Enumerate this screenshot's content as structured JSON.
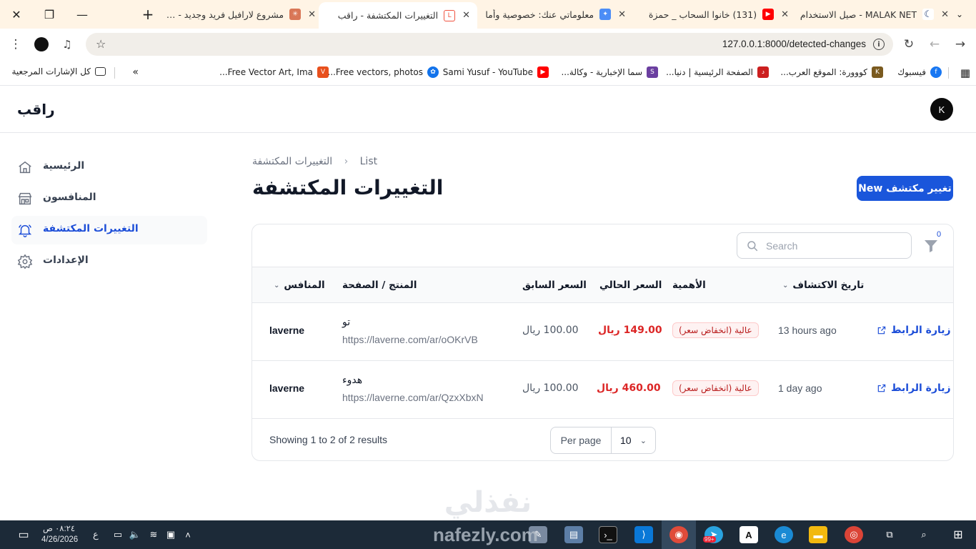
{
  "browser": {
    "tabs": [
      {
        "title": "MALAK NET - صيل الاستخدام",
        "favicon": "moon-icon"
      },
      {
        "title": "(131) خانوا السحاب _ حمزة",
        "favicon": "youtube-icon"
      },
      {
        "title": "معلوماتي عنك: خصوصية وأما",
        "favicon": "gemini-icon"
      },
      {
        "title": "التغييرات المكتشفة - راقب",
        "favicon": "laravel-icon",
        "active": true
      },
      {
        "title": "مشروع لارافيل فريد وجديد - Ide",
        "favicon": "claude-icon"
      }
    ],
    "url": "127.0.0.1:8000/detected-changes",
    "bookmarks": [
      {
        "label": "فيسبوك",
        "color": "#1877f2"
      },
      {
        "label": "كووورة: الموقع العرب...",
        "color": "#7a5a1f"
      },
      {
        "label": "الصفحة الرئيسية | دنيا...",
        "color": "#cc1f1f"
      },
      {
        "label": "سما الإخبارية - وكالة...",
        "color": "#6b3fa0"
      },
      {
        "label": "Sami Yusuf - YouTube",
        "color": "#ff0000"
      },
      {
        "label": "Free vectors, photos...",
        "color": "#1273eb"
      },
      {
        "label": "Free Vector Art, Ima...",
        "color": "#e8501d"
      }
    ],
    "all_bookmarks": "كل الإشارات المرجعية"
  },
  "app": {
    "brand": "راقب",
    "avatar": "K",
    "accent": "#1a56db"
  },
  "sidebar": {
    "items": [
      {
        "label": "الرئيسية",
        "icon": "home-icon"
      },
      {
        "label": "المنافسون",
        "icon": "store-icon"
      },
      {
        "label": "التغييرات المكتشفة",
        "icon": "bell-icon",
        "active": true
      },
      {
        "label": "الإعدادات",
        "icon": "gear-icon"
      }
    ]
  },
  "page": {
    "breadcrumb": [
      "التغييرات المكتشفة",
      "List"
    ],
    "title": "التغييرات المكتشفة",
    "new_button": "تغيير مكتشف New"
  },
  "table": {
    "search_placeholder": "Search",
    "filter_count": "0",
    "columns": {
      "date": "تاريخ الاكتشاف",
      "importance": "الأهمية",
      "current_price": "السعر الحالي",
      "previous_price": "السعر السابق",
      "product": "المنتج / الصفحة",
      "competitor": "المنافس"
    },
    "rows": [
      {
        "visit": "زيارة الرابط",
        "date": "13 hours ago",
        "importance": "عالية (انخفاض سعر)",
        "current_price": "149.00 ريال",
        "previous_price": "100.00 ريال",
        "product_name": "تو",
        "product_url": "https://laverne.com/ar/oOKrVB",
        "competitor": "laverne"
      },
      {
        "visit": "زيارة الرابط",
        "date": "1 day ago",
        "importance": "عالية (انخفاض سعر)",
        "current_price": "460.00 ريال",
        "previous_price": "100.00 ريال",
        "product_name": "هدوء",
        "product_url": "https://laverne.com/ar/QzxXbxN",
        "competitor": "laverne"
      }
    ],
    "results_text": "Showing 1 to 2 of 2 results",
    "per_page_label": "Per page",
    "per_page_value": "10"
  },
  "watermark": {
    "arabic": "نفذلي",
    "latin": "nafezly.com"
  },
  "taskbar": {
    "time": "٠٨:٢٤ ص",
    "date": "4/26/2026",
    "lang": "ع",
    "telegram_badge": "99+"
  }
}
